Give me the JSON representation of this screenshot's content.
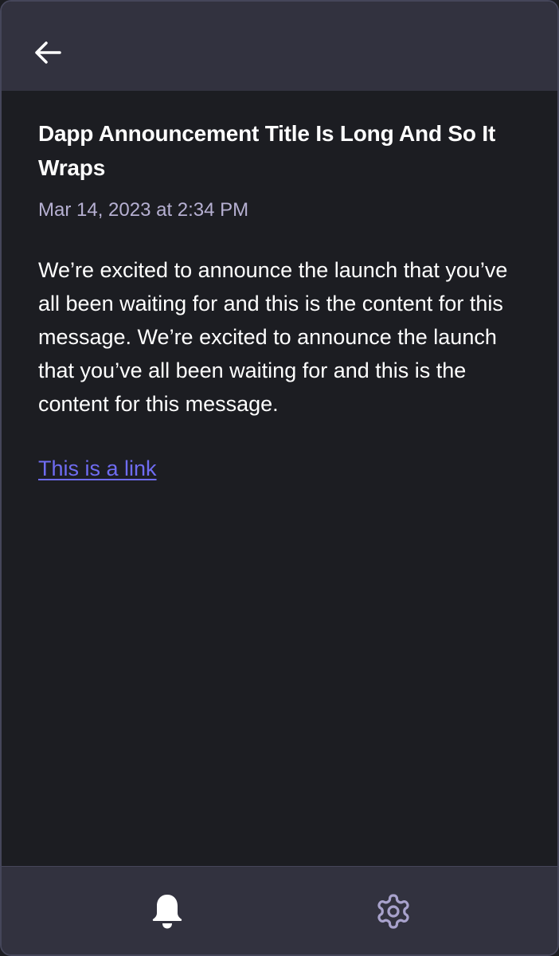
{
  "header": {
    "back_icon": "arrow-left-icon"
  },
  "message": {
    "title": "Dapp Announcement Title Is Long And So It Wraps",
    "timestamp": "Mar 14, 2023 at 2:34 PM",
    "body": "We’re excited to announce the launch that you’ve all been waiting for and this is the content for this message. We’re excited to announce the launch that you’ve all been waiting for and this is the content for this message.",
    "link_text": "This is a link"
  },
  "footer": {
    "nav": [
      {
        "icon": "bell-icon",
        "active": true
      },
      {
        "icon": "gear-icon",
        "active": false
      }
    ]
  },
  "colors": {
    "background": "#1c1d22",
    "bar": "#32323f",
    "timestamp": "#b6b0d2",
    "link": "#6f6cf2",
    "inactive_icon": "#a8a2cc"
  }
}
